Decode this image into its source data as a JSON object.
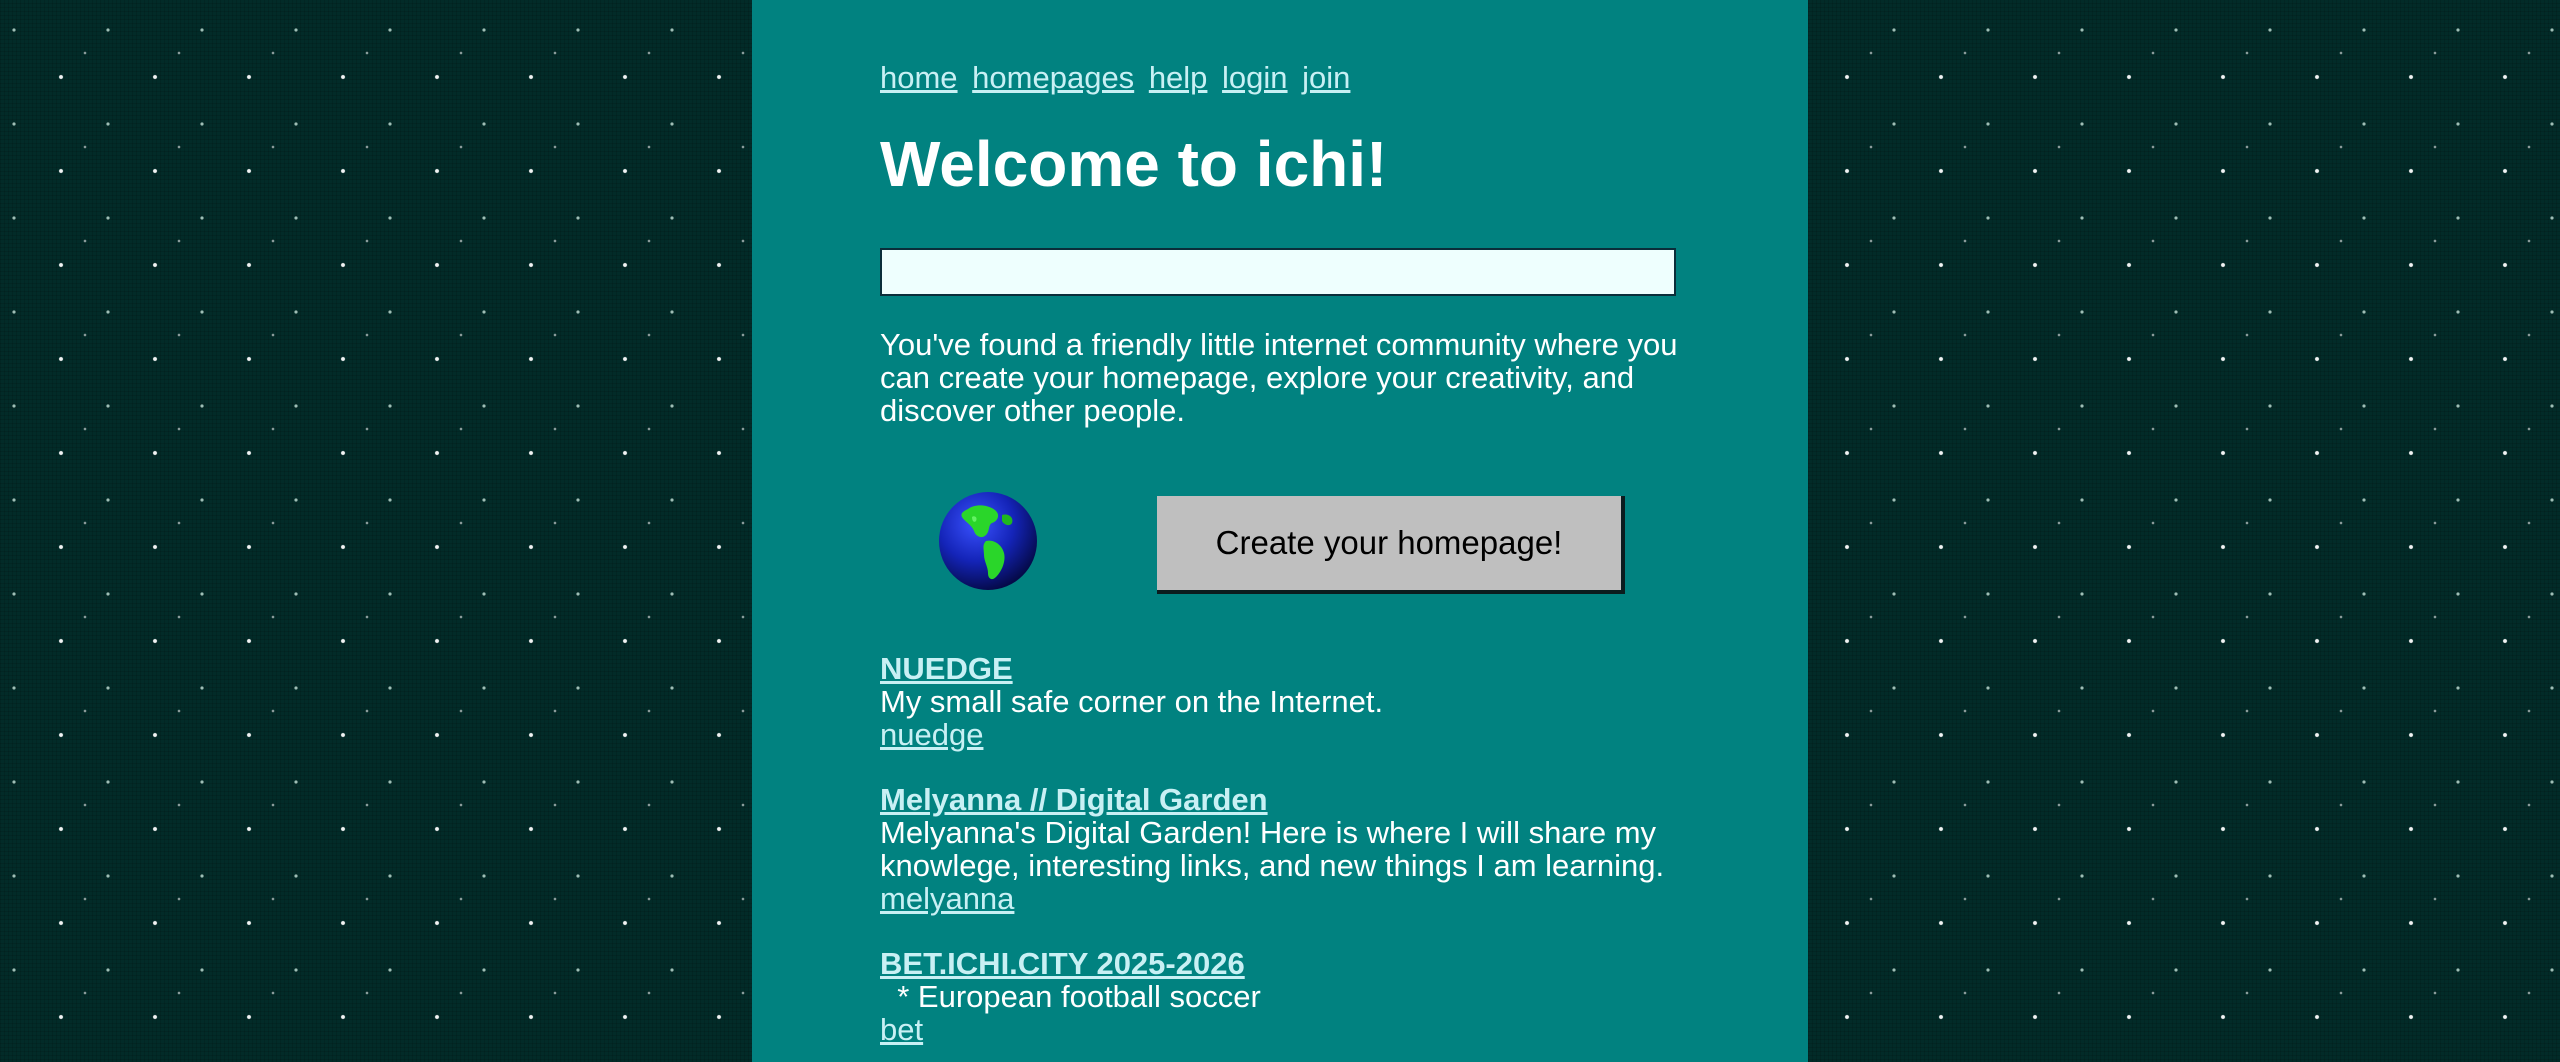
{
  "nav": {
    "links": [
      "home",
      "homepages",
      "help",
      "login",
      "join"
    ]
  },
  "page": {
    "title": "Welcome to ichi!",
    "intro": "You've found a friendly little internet community where you can create your homepage, explore your creativity, and discover other people.",
    "create_button": "Create your homepage!",
    "search_value": ""
  },
  "icons": {
    "globe": "globe-icon"
  },
  "colors": {
    "column_bg": "#018280",
    "page_bg": "#022b28",
    "link": "#c8f0f4",
    "button_bg": "#bfbfbf",
    "input_bg": "#eefffe"
  },
  "listings": [
    {
      "title": "NUEDGE",
      "description": "My small safe corner on the Internet.",
      "user": "nuedge"
    },
    {
      "title": "Melyanna // Digital Garden",
      "description": "Melyanna's Digital Garden! Here is where I will share my knowlege, interesting links, and new things I am learning.",
      "user": "melyanna"
    },
    {
      "title": "BET.ICHI.CITY 2025-2026",
      "description": "  * European football soccer",
      "user": "bet"
    }
  ]
}
